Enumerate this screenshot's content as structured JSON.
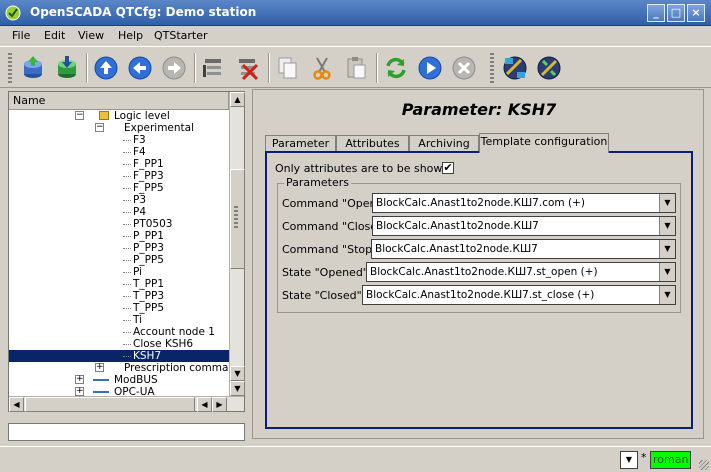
{
  "window": {
    "title": "OpenSCADA QTCfg: Demo station",
    "controls": {
      "minimize": "_",
      "maximize": "□",
      "close": "×"
    }
  },
  "menu": [
    "File",
    "Edit",
    "View",
    "Help",
    "QTStarter"
  ],
  "toolbar": {
    "icons": [
      "db-load-icon",
      "db-save-icon",
      "up-arrow-icon",
      "back-arrow-icon",
      "forward-arrow-icon",
      "add-item-icon",
      "delete-item-icon",
      "copy-icon",
      "cut-icon",
      "paste-icon",
      "refresh-icon",
      "start-icon",
      "stop-icon",
      "network-icon",
      "settings-icon"
    ]
  },
  "tree": {
    "header": "Name",
    "rows": [
      {
        "label": "Logic level",
        "level": 0,
        "expander": "−",
        "icon": "folder"
      },
      {
        "label": "Experimental",
        "level": 1,
        "expander": "−",
        "icon": ""
      },
      {
        "label": "F3",
        "level": 2
      },
      {
        "label": "F4",
        "level": 2
      },
      {
        "label": "F_PP1",
        "level": 2
      },
      {
        "label": "F_PP3",
        "level": 2
      },
      {
        "label": "F_PP5",
        "level": 2
      },
      {
        "label": "P3",
        "level": 2
      },
      {
        "label": "P4",
        "level": 2
      },
      {
        "label": "PT0503",
        "level": 2
      },
      {
        "label": "P_PP1",
        "level": 2
      },
      {
        "label": "P_PP3",
        "level": 2
      },
      {
        "label": "P_PP5",
        "level": 2
      },
      {
        "label": "Pi",
        "level": 2
      },
      {
        "label": "T_PP1",
        "level": 2
      },
      {
        "label": "T_PP3",
        "level": 2
      },
      {
        "label": "T_PP5",
        "level": 2
      },
      {
        "label": "Ti",
        "level": 2
      },
      {
        "label": "Account node 1",
        "level": 2
      },
      {
        "label": "Close KSH6",
        "level": 2
      },
      {
        "label": "KSH7",
        "level": 2,
        "selected": true
      },
      {
        "label": "Prescription commands",
        "level": 1,
        "expander": "+"
      },
      {
        "label": "ModBUS",
        "level": 0,
        "expander": "+",
        "icon": "modbus"
      },
      {
        "label": "OPC-UA",
        "level": 0,
        "expander": "+",
        "icon": "modbus"
      }
    ]
  },
  "page": {
    "title": "Parameter: KSH7",
    "tabs": [
      "Parameter",
      "Attributes",
      "Archiving",
      "Template configuration"
    ],
    "active_tab": 3,
    "only_attributes_label": "Only attributes are to be shown:",
    "only_attributes_checked": true,
    "check_mark": "✔",
    "group_title": "Parameters",
    "fields": [
      {
        "label": "Command \"Open\":",
        "value": "BlockCalc.Anast1to2node.КШ7.com (+)"
      },
      {
        "label": "Command \"Close\":",
        "value": "BlockCalc.Anast1to2node.КШ7"
      },
      {
        "label": "Command \"Stop\":",
        "value": "BlockCalc.Anast1to2node.КШ7"
      },
      {
        "label": "State \"Opened\":",
        "value": "BlockCalc.Anast1to2node.КШ7.st_open (+)"
      },
      {
        "label": "State \"Closed\":",
        "value": "BlockCalc.Anast1to2node.КШ7.st_close (+)"
      }
    ]
  },
  "status": {
    "star": "*",
    "user": "roman"
  }
}
